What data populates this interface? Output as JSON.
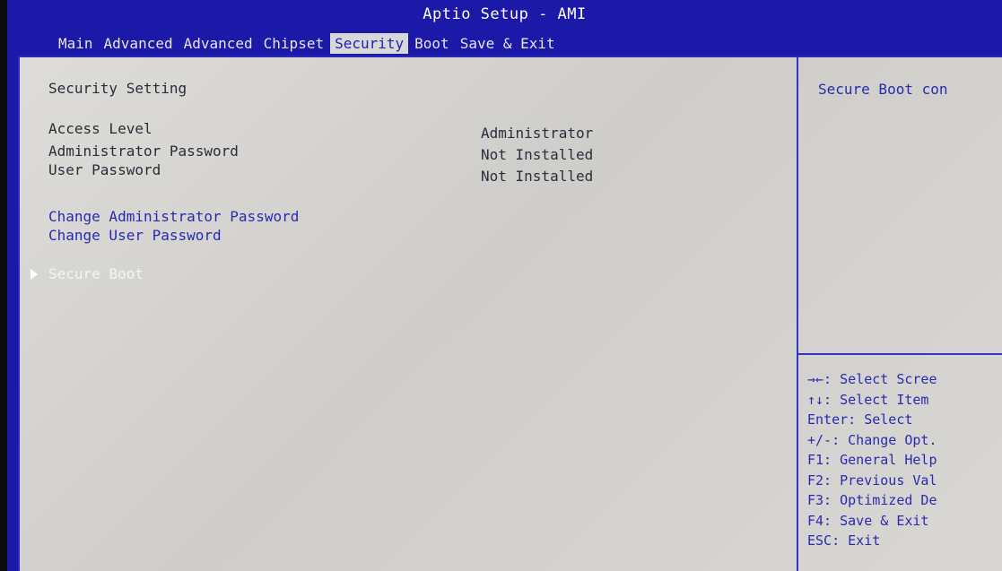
{
  "header": {
    "title": "Aptio Setup - AMI",
    "tabs": [
      {
        "label": "Main"
      },
      {
        "label": "Advanced"
      },
      {
        "label": "Advanced"
      },
      {
        "label": "Chipset"
      },
      {
        "label": "Security"
      },
      {
        "label": "Boot"
      },
      {
        "label": "Save & Exit"
      }
    ],
    "active_tab": "Security"
  },
  "main": {
    "section_title": "Security Setting",
    "info_rows": [
      {
        "label": "Access Level",
        "value": "Administrator"
      },
      {
        "label": "Administrator Password",
        "value": "Not Installed"
      },
      {
        "label": "User Password",
        "value": "Not Installed"
      }
    ],
    "actions": [
      {
        "label": "Change Administrator Password"
      },
      {
        "label": "Change User Password"
      }
    ],
    "submenu": {
      "label": "Secure Boot"
    }
  },
  "help_panel": {
    "description": "Secure Boot con",
    "keys": [
      "→←: Select Scree",
      "↑↓: Select Item",
      "Enter: Select",
      "+/-: Change Opt.",
      "F1: General Help",
      "F2: Previous Val",
      "F3: Optimized De",
      "F4: Save & Exit",
      "ESC: Exit"
    ]
  },
  "colors": {
    "bios_blue": "#1c18a8",
    "panel_gray": "#d6d4d0",
    "selected_text": "#ffffff",
    "item_blue": "#2a2ab0"
  }
}
